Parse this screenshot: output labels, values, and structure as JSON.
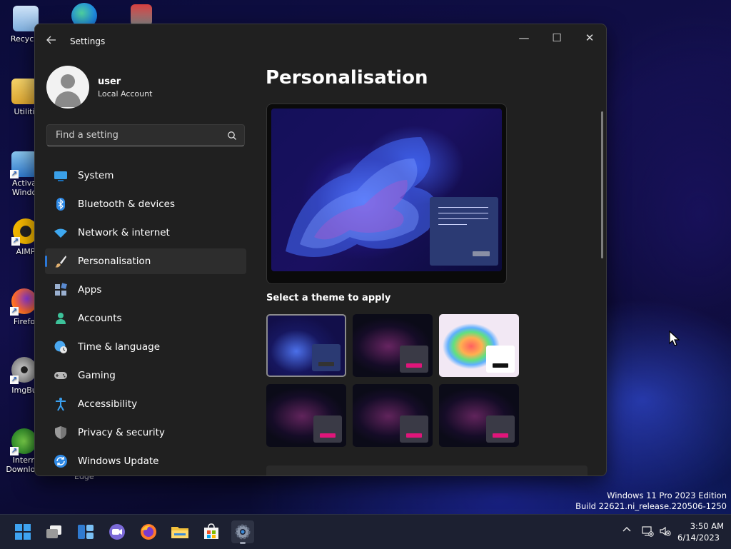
{
  "desktop": {
    "icons": [
      {
        "label": "Recycle"
      },
      {
        "label": "Utiliti"
      },
      {
        "label": "Activa\nWindo"
      },
      {
        "label": "AIMP"
      },
      {
        "label": "Firefo"
      },
      {
        "label": "ImgBu"
      },
      {
        "label": "Intern\nDownlo..."
      }
    ],
    "behind_label": "Edge",
    "watermark": {
      "line1": "Windows 11 Pro 2023 Edition",
      "line2": "Build 22621.ni_release.220506-1250"
    }
  },
  "window": {
    "title": "Settings",
    "back_icon": "arrow-left-icon",
    "controls": {
      "minimize": "—",
      "maximize": "☐",
      "close": "✕"
    }
  },
  "profile": {
    "name": "user",
    "account_type": "Local Account"
  },
  "search": {
    "placeholder": "Find a setting"
  },
  "nav": {
    "items": [
      {
        "label": "System",
        "icon": "monitor-icon",
        "color": "#3aa0e8"
      },
      {
        "label": "Bluetooth & devices",
        "icon": "bluetooth-icon",
        "color": "#2f8ae6"
      },
      {
        "label": "Network & internet",
        "icon": "wifi-icon",
        "color": "#3ea8f0"
      },
      {
        "label": "Personalisation",
        "icon": "brush-icon",
        "color": "#e0b070",
        "active": true
      },
      {
        "label": "Apps",
        "icon": "apps-icon",
        "color": "#9ab0d0"
      },
      {
        "label": "Accounts",
        "icon": "person-icon",
        "color": "#3dc29a"
      },
      {
        "label": "Time & language",
        "icon": "globe-clock-icon",
        "color": "#4aa8f0"
      },
      {
        "label": "Gaming",
        "icon": "gamepad-icon",
        "color": "#b8b8b8"
      },
      {
        "label": "Accessibility",
        "icon": "accessibility-icon",
        "color": "#3aa0f0"
      },
      {
        "label": "Privacy & security",
        "icon": "shield-icon",
        "color": "#9a9a9a"
      },
      {
        "label": "Windows Update",
        "icon": "update-icon",
        "color": "#2f8ae6"
      }
    ]
  },
  "main": {
    "title": "Personalisation",
    "themes_label": "Select a theme to apply",
    "themes": [
      {
        "name": "theme-1",
        "selected": true,
        "accent": "#2b3a73",
        "bar": "#333"
      },
      {
        "name": "theme-2",
        "selected": false,
        "accent": "#3a3a46",
        "bar": "#e0157a"
      },
      {
        "name": "theme-3",
        "selected": false,
        "accent": "#ffffff",
        "bar": "#111"
      },
      {
        "name": "theme-4",
        "selected": false,
        "accent": "#3a3a46",
        "bar": "#e0157a"
      },
      {
        "name": "theme-5",
        "selected": false,
        "accent": "#3a3a46",
        "bar": "#e0157a"
      },
      {
        "name": "theme-6",
        "selected": false,
        "accent": "#3a3a46",
        "bar": "#e0157a"
      }
    ]
  },
  "taskbar": {
    "apps": [
      "start-icon",
      "task-view-icon",
      "widgets-icon",
      "chat-icon",
      "firefox-icon",
      "file-explorer-icon",
      "store-icon",
      "settings-icon"
    ],
    "clock": {
      "time": "3:50 AM",
      "date": "6/14/2023"
    }
  }
}
